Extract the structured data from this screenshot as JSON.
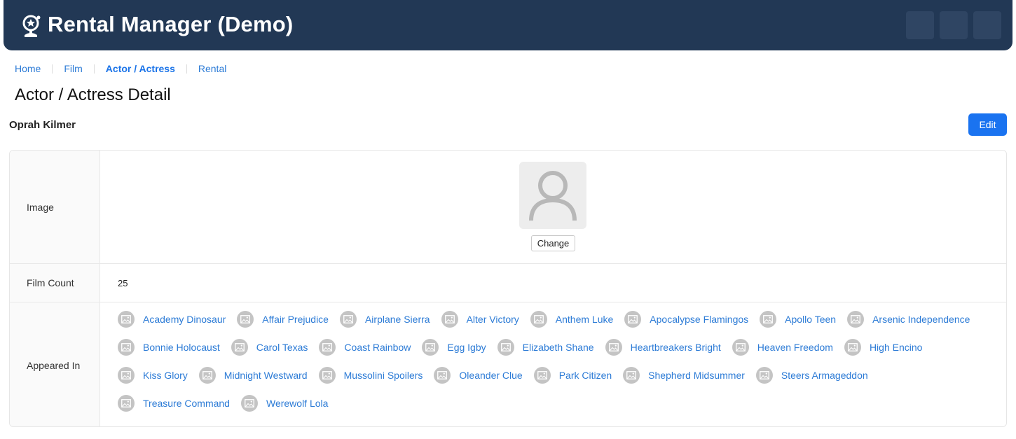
{
  "app": {
    "title": "Rental Manager (Demo)"
  },
  "breadcrumb": [
    {
      "label": "Home",
      "active": false
    },
    {
      "label": "Film",
      "active": false
    },
    {
      "label": "Actor / Actress",
      "active": true
    },
    {
      "label": "Rental",
      "active": false
    }
  ],
  "page": {
    "title": "Actor / Actress Detail"
  },
  "record": {
    "name": "Oprah Kilmer",
    "edit_label": "Edit"
  },
  "fields": {
    "image_label": "Image",
    "change_label": "Change",
    "film_count_label": "Film Count",
    "film_count": "25",
    "appeared_in_label": "Appeared In"
  },
  "films": [
    "Academy Dinosaur",
    "Affair Prejudice",
    "Airplane Sierra",
    "Alter Victory",
    "Anthem Luke",
    "Apocalypse Flamingos",
    "Apollo Teen",
    "Arsenic Independence",
    "Bonnie Holocaust",
    "Carol Texas",
    "Coast Rainbow",
    "Egg Igby",
    "Elizabeth Shane",
    "Heartbreakers Bright",
    "Heaven Freedom",
    "High Encino",
    "Kiss Glory",
    "Midnight Westward",
    "Mussolini Spoilers",
    "Oleander Clue",
    "Park Citizen",
    "Shepherd Midsummer",
    "Steers Armageddon",
    "Treasure Command",
    "Werewolf Lola"
  ],
  "icons": {
    "logo": "camera-award-icon",
    "avatar": "user-placeholder-icon",
    "film": "image-placeholder-icon"
  },
  "colors": {
    "header": "#223855",
    "link": "#2c7bd6",
    "primary_button": "#1a73f0"
  }
}
